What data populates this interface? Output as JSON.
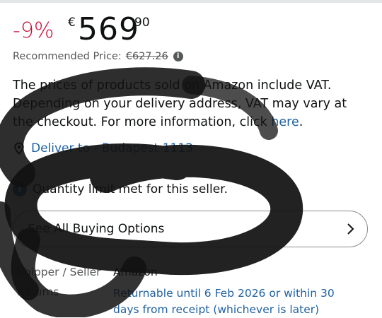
{
  "price": {
    "discount": "-9%",
    "currency": "€",
    "whole": "569",
    "fraction": "90"
  },
  "recommended": {
    "label": "Recommended Price:",
    "value": "€627.26",
    "info_icon": "info-circle-icon"
  },
  "vat_notice": {
    "text": "The prices of products sold on Amazon include VAT. Depending on your delivery address, VAT may vary at the checkout. For more information, click ",
    "link": "here",
    "end": "."
  },
  "delivery": {
    "icon": "location-pin-icon",
    "label": "Deliver to - Budapest 1113"
  },
  "quantity_limit": {
    "icon": "info-icon",
    "text": "Quantity limit met for this seller."
  },
  "buying_options": {
    "label": "See All Buying Options",
    "icon": "chevron-right-icon"
  },
  "details": {
    "shipper_label": "Shipper / Seller",
    "shipper_value": "Amazon",
    "returns_label": "Returns",
    "returns_value": "Returnable until 6 Feb 2026 or within 30 days from receipt (whichever is later)"
  },
  "colors": {
    "discount": "#cc0c39",
    "link": "#2162a1",
    "scribble": "#111111"
  }
}
